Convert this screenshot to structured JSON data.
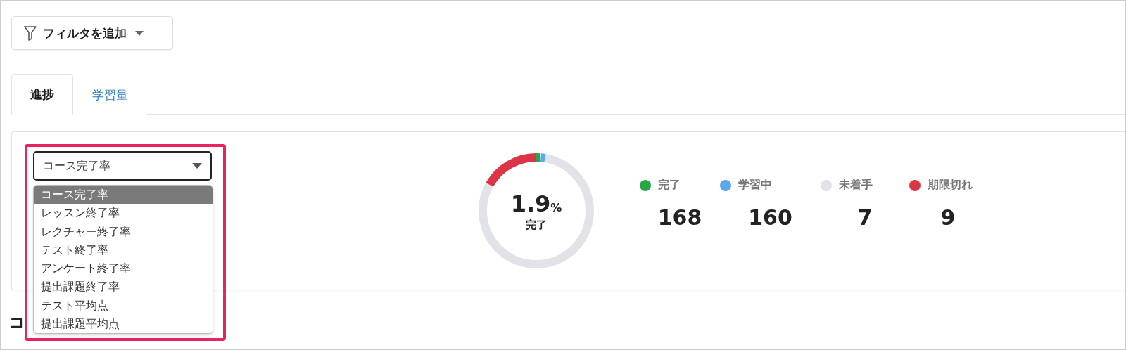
{
  "filter_button": {
    "label": "フィルタを追加"
  },
  "tabs": [
    {
      "label": "進捗",
      "selected": true
    },
    {
      "label": "学習量",
      "selected": false
    }
  ],
  "metric_select": {
    "value": "コース完了率",
    "highlighted": true,
    "options": [
      {
        "label": "コース完了率",
        "selected": true
      },
      {
        "label": "レッスン終了率",
        "selected": false
      },
      {
        "label": "レクチャー終了率",
        "selected": false
      },
      {
        "label": "テスト終了率",
        "selected": false
      },
      {
        "label": "アンケート終了率",
        "selected": false
      },
      {
        "label": "提出課題終了率",
        "selected": false
      },
      {
        "label": "テスト平均点",
        "selected": false
      },
      {
        "label": "提出課題平均点",
        "selected": false
      }
    ]
  },
  "summary": {
    "percent": "1.9",
    "percent_unit": "%",
    "percent_label": "完了",
    "legend": [
      {
        "label": "完了",
        "color": "#28a745",
        "count": "168"
      },
      {
        "label": "学習中",
        "color": "#5aa9f0",
        "count": "160"
      },
      {
        "label": "未着手",
        "color": "#e1e3e8",
        "count": "7"
      },
      {
        "label": "期限切れ",
        "color": "#dc3545",
        "count": "9"
      }
    ]
  },
  "section_heading": "コ"
}
